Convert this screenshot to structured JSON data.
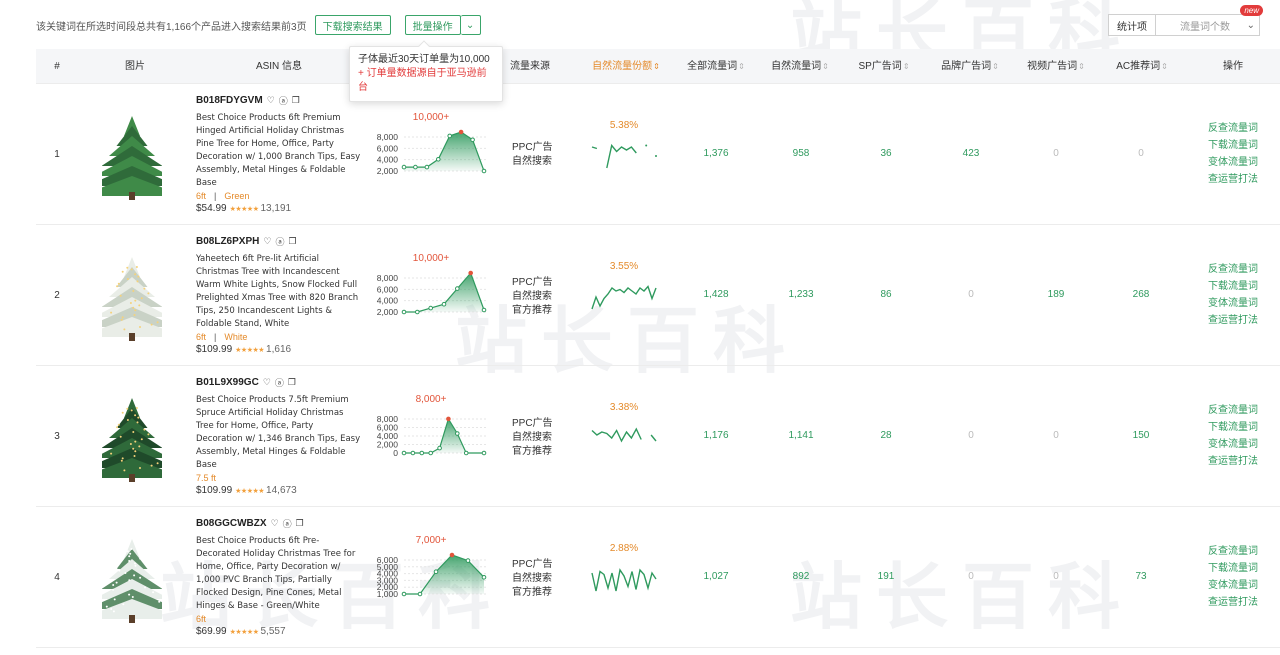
{
  "toolbar": {
    "summary": "该关键词在所选时间段总共有1,166个产品进入搜索结果前3页",
    "download_label": "下载搜索结果",
    "batch_label": "批量操作",
    "stats_label": "统计项",
    "stats_select": "流量词个数",
    "new_badge": "new"
  },
  "tooltip": {
    "line1": "子体最近30天订单量为10,000",
    "line2": "+ 订单量数据源自于亚马逊前台"
  },
  "watermark": "站长百科",
  "headers": [
    {
      "key": "idx",
      "label": "#",
      "sortable": false
    },
    {
      "key": "image",
      "label": "图片",
      "sortable": false
    },
    {
      "key": "asin",
      "label": "ASIN 信息",
      "sortable": false
    },
    {
      "key": "sales",
      "label": "",
      "sortable": false
    },
    {
      "key": "source",
      "label": "流量来源",
      "sortable": false
    },
    {
      "key": "organic_share",
      "label": "自然流量份额",
      "sortable": true,
      "active": true
    },
    {
      "key": "all",
      "label": "全部流量词",
      "sortable": true
    },
    {
      "key": "organic",
      "label": "自然流量词",
      "sortable": true
    },
    {
      "key": "sp",
      "label": "SP广告词",
      "sortable": true
    },
    {
      "key": "brand",
      "label": "品牌广告词",
      "sortable": true
    },
    {
      "key": "video",
      "label": "视频广告词",
      "sortable": true
    },
    {
      "key": "ac",
      "label": "AC推荐词",
      "sortable": true
    },
    {
      "key": "ops",
      "label": "操作",
      "sortable": false
    }
  ],
  "ops_labels": [
    "反查流量词",
    "下载流量词",
    "变体流量词",
    "查运营打法"
  ],
  "colors": {
    "green": "#2f9a5e",
    "orange": "#e48a2a",
    "red": "#e23b3b",
    "zero": "#bbbbbb"
  },
  "rows": [
    {
      "idx": "1",
      "asin": "B018FDYGVM",
      "title": "Best Choice Products 6ft Premium Hinged Artificial Holiday Christmas Pine Tree for Home, Office, Party Decoration w/ 1,000 Branch Tips, Easy Assembly, Metal Hinges & Foldable Base",
      "variant": [
        "6ft",
        "Green"
      ],
      "price": "$54.99",
      "reviews": "13,191",
      "rating": 4.5,
      "tree": "green",
      "sales_peak": "10,000+",
      "sales_ticks": [
        "8,000",
        "6,000",
        "4,000",
        "2,000"
      ],
      "sales_max": 10000,
      "sales_series": [
        1000,
        1000,
        1000,
        3000,
        9000,
        10000,
        8000,
        0
      ],
      "sources": [
        "PPC广告",
        "自然搜索"
      ],
      "organic_share": "5.38%",
      "share_series": [
        0.9,
        0.85,
        null,
        0.2,
        0.95,
        0.75,
        0.9,
        0.8,
        0.9,
        0.7,
        null,
        0.95,
        null,
        0.6
      ],
      "all": "1,376",
      "organic": "958",
      "sp": "36",
      "brand": "423",
      "video": "0",
      "ac": "0"
    },
    {
      "idx": "2",
      "asin": "B08LZ6PXPH",
      "title": "Yaheetech 6ft Pre-lit Artificial Christmas Tree with Incandescent Warm White Lights, Snow Flocked Full Prelighted Xmas Tree with 820 Branch Tips, 250 Incandescent Lights & Foldable Stand, White",
      "variant": [
        "6ft",
        "White"
      ],
      "price": "$109.99",
      "reviews": "1,616",
      "rating": 4.5,
      "tree": "snow",
      "sales_peak": "10,000+",
      "sales_ticks": [
        "8,000",
        "6,000",
        "4,000",
        "2,000"
      ],
      "sales_max": 10000,
      "sales_series": [
        0,
        0,
        1000,
        2000,
        6000,
        10000,
        500
      ],
      "sources": [
        "PPC广告",
        "自然搜索",
        "官方推荐"
      ],
      "organic_share": "3.55%",
      "share_series": [
        0.2,
        0.6,
        0.3,
        0.55,
        0.7,
        0.9,
        0.8,
        0.85,
        0.75,
        0.9,
        0.8,
        0.7,
        0.9,
        0.8,
        0.95,
        0.55,
        0.9
      ],
      "all": "1,428",
      "organic": "1,233",
      "sp": "86",
      "brand": "0",
      "video": "189",
      "ac": "268"
    },
    {
      "idx": "3",
      "asin": "B01L9X99GC",
      "title": "Best Choice Products 7.5ft Premium Spruce Artificial Holiday Christmas Tree for Home, Office, Party Decoration w/ 1,346 Branch Tips, Easy Assembly, Metal Hinges & Foldable Base",
      "variant": [
        "7.5 ft"
      ],
      "price": "$109.99",
      "reviews": "14,673",
      "rating": 4.5,
      "tree": "dark",
      "sales_peak": "8,000+",
      "sales_ticks": [
        "8,000",
        "6,000",
        "4,000",
        "2,000",
        "0"
      ],
      "sales_max": 8000,
      "sales_series": [
        0,
        0,
        0,
        0,
        1000,
        7000,
        4000,
        0,
        null,
        0
      ],
      "sources": [
        "PPC广告",
        "自然搜索",
        "官方推荐"
      ],
      "organic_share": "3.38%",
      "share_series": [
        0.85,
        0.7,
        0.8,
        0.75,
        0.6,
        0.85,
        0.5,
        0.8,
        0.6,
        0.9,
        0.55,
        null,
        0.7,
        0.5
      ],
      "all": "1,176",
      "organic": "1,141",
      "sp": "28",
      "brand": "0",
      "video": "0",
      "ac": "150"
    },
    {
      "idx": "4",
      "asin": "B08GGCWBZX",
      "title": "Best Choice Products 6ft Pre-Decorated Holiday Christmas Tree for Home, Office, Party Decoration w/ 1,000 PVC Branch Tips, Partially Flocked Design, Pine Cones, Metal Hinges & Base - Green/White",
      "variant": [
        "6ft"
      ],
      "price": "$69.99",
      "reviews": "5,557",
      "rating": 4.5,
      "tree": "frost",
      "sales_peak": "7,000+",
      "sales_ticks": [
        "6,000",
        "5,000",
        "4,000",
        "3,000",
        "2,000",
        "1,000"
      ],
      "sales_max": 7000,
      "sales_series": [
        0,
        0,
        4000,
        7000,
        6000,
        3000
      ],
      "sources": [
        "PPC广告",
        "自然搜索",
        "官方推荐"
      ],
      "organic_share": "2.88%",
      "share_series": [
        0.8,
        0.2,
        0.85,
        0.75,
        0.3,
        0.8,
        0.2,
        0.9,
        0.7,
        0.35,
        0.85,
        0.25,
        0.9,
        0.75,
        0.3,
        0.8,
        0.6
      ],
      "all": "1,027",
      "organic": "892",
      "sp": "191",
      "brand": "0",
      "video": "0",
      "ac": "73"
    }
  ]
}
